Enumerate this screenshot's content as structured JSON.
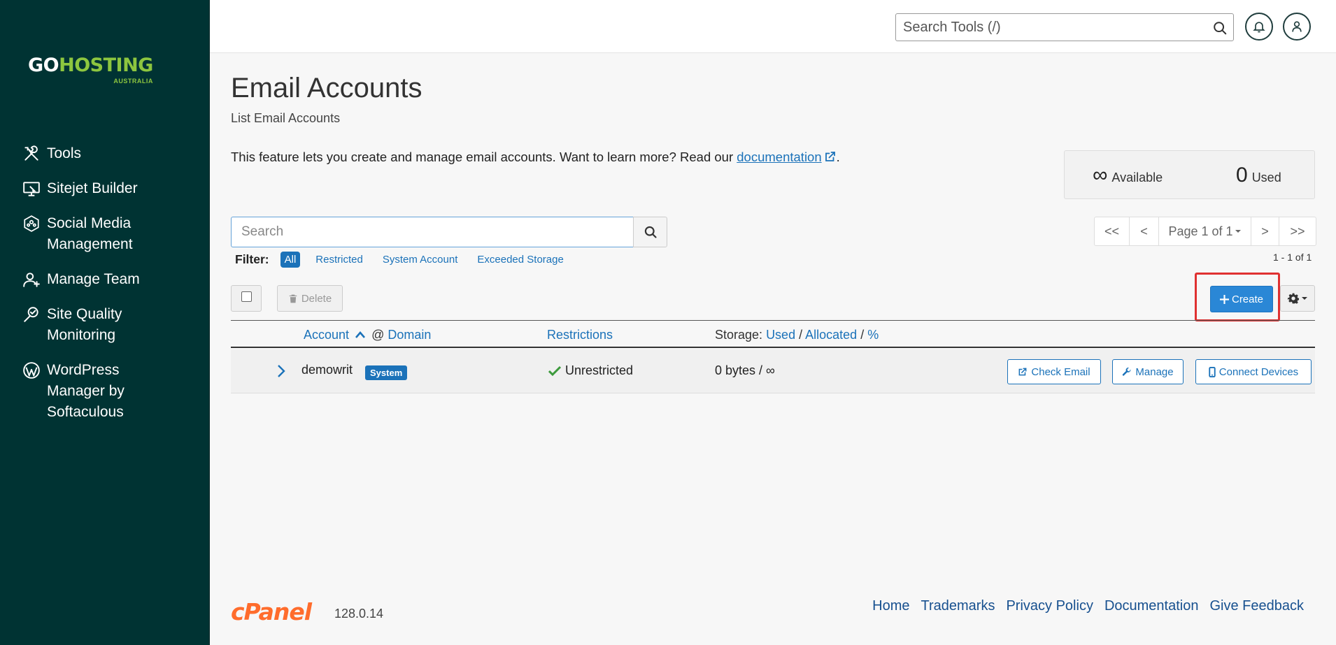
{
  "brand": {
    "word_go": "GO",
    "word_hosting": "HOSTING",
    "sub": "AUSTRALIA",
    "colors": {
      "sidebar": "#003333",
      "green": "#8dc63f",
      "accent": "#1b72b9",
      "cpanel": "#ff6c2c"
    }
  },
  "sidebar": {
    "items": [
      {
        "label": "Tools",
        "icon": "tools-icon"
      },
      {
        "label": "Sitejet Builder",
        "icon": "monitor-icon"
      },
      {
        "label": "Social Media Management",
        "icon": "social-hexagon-icon"
      },
      {
        "label": "Manage Team",
        "icon": "add-user-icon"
      },
      {
        "label": "Site Quality Monitoring",
        "icon": "magnifier-check-icon"
      },
      {
        "label": "WordPress Manager by Softaculous",
        "icon": "wordpress-icon"
      }
    ]
  },
  "topbar": {
    "search_placeholder": "Search Tools (/)"
  },
  "page": {
    "title": "Email Accounts",
    "subtitle": "List Email Accounts",
    "intro_text": "This feature lets you create and manage email accounts. Want to learn more? Read our ",
    "intro_link": "documentation",
    "intro_end": "."
  },
  "stats": {
    "available_value": "∞",
    "available_label": "Available",
    "used_value": "0",
    "used_label": "Used"
  },
  "search": {
    "placeholder": "Search"
  },
  "filter": {
    "label": "Filter:",
    "options": [
      "All",
      "Restricted",
      "System Account",
      "Exceeded Storage"
    ],
    "active": "All"
  },
  "pager": {
    "first": "<<",
    "prev": "<",
    "page": "Page 1 of 1",
    "next": ">",
    "last": ">>",
    "range": "1 - 1 of 1"
  },
  "toolbar": {
    "delete_label": "Delete",
    "create_label": "Create"
  },
  "table": {
    "headers": {
      "account": "Account",
      "at": "@",
      "domain": "Domain",
      "restrictions": "Restrictions",
      "storage_prefix": "Storage:",
      "used": "Used",
      "allocated": "Allocated",
      "percent": "%",
      "sep": "/"
    },
    "rows": [
      {
        "account": "demowrit",
        "badge": "System",
        "restriction": "Unrestricted",
        "storage": "0 bytes / ∞",
        "actions": [
          "Check Email",
          "Manage",
          "Connect Devices"
        ]
      }
    ]
  },
  "footer": {
    "logo": "cPanel",
    "version": "128.0.14",
    "links": [
      "Home",
      "Trademarks",
      "Privacy Policy",
      "Documentation",
      "Give Feedback"
    ]
  }
}
